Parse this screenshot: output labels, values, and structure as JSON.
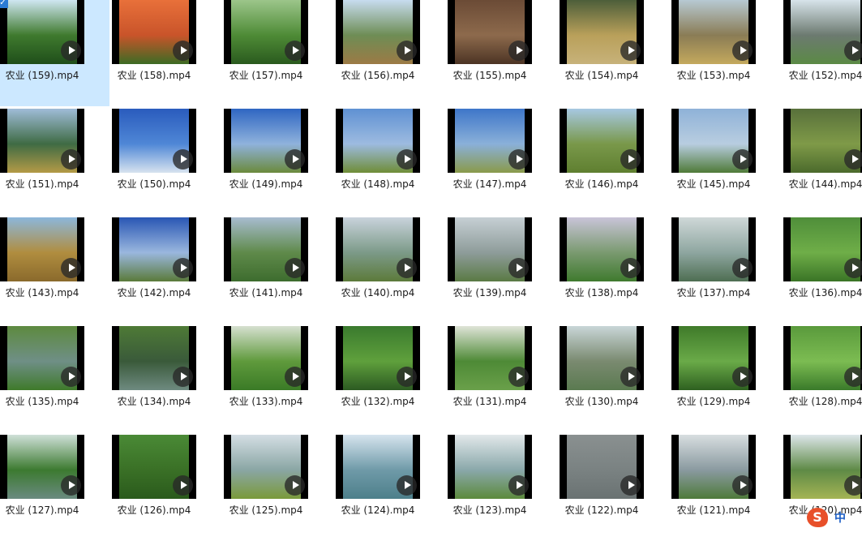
{
  "files": [
    {
      "name": "农业 (159).mp4",
      "g": [
        "#cfe6f2",
        "#3f7a2e",
        "#1f4e1a"
      ],
      "selected": true
    },
    {
      "name": "农业 (158).mp4",
      "g": [
        "#e8703a",
        "#c9542a",
        "#3c6b24"
      ]
    },
    {
      "name": "农业 (157).mp4",
      "g": [
        "#9cc58a",
        "#4e8b36",
        "#2a5a1e"
      ]
    },
    {
      "name": "农业 (156).mp4",
      "g": [
        "#c7dcef",
        "#6e8d55",
        "#9c7a45"
      ]
    },
    {
      "name": "农业 (155).mp4",
      "g": [
        "#6b4b36",
        "#8d6a4c",
        "#4c3424"
      ]
    },
    {
      "name": "农业 (154).mp4",
      "g": [
        "#4d5e3a",
        "#b9a05a",
        "#c7b27a"
      ]
    },
    {
      "name": "农业 (153).mp4",
      "g": [
        "#b7c9d2",
        "#8a7c55",
        "#c4a95d"
      ]
    },
    {
      "name": "农业 (152).mp4",
      "g": [
        "#d7e3ea",
        "#6c7a70",
        "#5b8a45"
      ]
    },
    {
      "name": "农业 (151).mp4",
      "g": [
        "#9fbcd8",
        "#3f6b44",
        "#b49a46"
      ]
    },
    {
      "name": "农业 (150).mp4",
      "g": [
        "#2a5bbd",
        "#4f87d6",
        "#d7e3ef"
      ]
    },
    {
      "name": "农业 (149).mp4",
      "g": [
        "#2f66c2",
        "#8fb2dc",
        "#6b8a3c"
      ]
    },
    {
      "name": "农业 (148).mp4",
      "g": [
        "#5f91d3",
        "#9dbbe0",
        "#6f8d37"
      ]
    },
    {
      "name": "农业 (147).mp4",
      "g": [
        "#3e76c9",
        "#8ab0d9",
        "#8a9a4a"
      ]
    },
    {
      "name": "农业 (146).mp4",
      "g": [
        "#a7c8e2",
        "#79984a",
        "#5f7f30"
      ]
    },
    {
      "name": "农业 (145).mp4",
      "g": [
        "#8fb2d8",
        "#b8cde0",
        "#4f7a38"
      ]
    },
    {
      "name": "农业 (144).mp4",
      "g": [
        "#58703b",
        "#7f9a48",
        "#4b6a2c"
      ]
    },
    {
      "name": "农业 (143).mp4",
      "g": [
        "#8cb7db",
        "#b08d3f",
        "#8a6a2c"
      ]
    },
    {
      "name": "农业 (142).mp4",
      "g": [
        "#2956b4",
        "#9ab7de",
        "#5a7a3a"
      ]
    },
    {
      "name": "农业 (141).mp4",
      "g": [
        "#a8bcd0",
        "#5f8a4a",
        "#3d6c2e"
      ]
    },
    {
      "name": "农业 (140).mp4",
      "g": [
        "#c9d3dc",
        "#7c9a88",
        "#5c7a3a"
      ]
    },
    {
      "name": "农业 (139).mp4",
      "g": [
        "#c6cfd4",
        "#8e9c9a",
        "#5a7a44"
      ]
    },
    {
      "name": "农业 (138).mp4",
      "g": [
        "#c9c4d8",
        "#7a9a70",
        "#3f7a2e"
      ]
    },
    {
      "name": "农业 (137).mp4",
      "g": [
        "#cfd8d8",
        "#8ea6a0",
        "#4e6e52"
      ]
    },
    {
      "name": "农业 (136).mp4",
      "g": [
        "#4f8e3a",
        "#6fae48",
        "#3a7426"
      ]
    },
    {
      "name": "农业 (135).mp4",
      "g": [
        "#5d8a3f",
        "#6f8f86",
        "#3f7a2a"
      ]
    },
    {
      "name": "农业 (134).mp4",
      "g": [
        "#4e7a36",
        "#3a5a3a",
        "#6e8a80"
      ]
    },
    {
      "name": "农业 (133).mp4",
      "g": [
        "#d6e0d0",
        "#5f9a3c",
        "#3a7a26"
      ]
    },
    {
      "name": "农业 (132).mp4",
      "g": [
        "#3a7a2e",
        "#5fa03c",
        "#2c5a22"
      ]
    },
    {
      "name": "农业 (131).mp4",
      "g": [
        "#dfe4d8",
        "#4e8a36",
        "#6aa04a"
      ]
    },
    {
      "name": "农业 (130).mp4",
      "g": [
        "#c9d6d8",
        "#7a8a70",
        "#5a7a50"
      ]
    },
    {
      "name": "农业 (129).mp4",
      "g": [
        "#3f7a2a",
        "#6aaa48",
        "#2e6020"
      ]
    },
    {
      "name": "农业 (128).mp4",
      "g": [
        "#5a9a3c",
        "#7cbc52",
        "#3a7a2a"
      ]
    },
    {
      "name": "农业 (127).mp4",
      "g": [
        "#cfe0d8",
        "#3c7a30",
        "#6a8a80"
      ]
    },
    {
      "name": "农业 (126).mp4",
      "g": [
        "#4a8a36",
        "#3a7026",
        "#2a5a1c"
      ]
    },
    {
      "name": "农业 (125).mp4",
      "g": [
        "#d4dee4",
        "#8aa6a4",
        "#7a9a3a"
      ]
    },
    {
      "name": "农业 (124).mp4",
      "g": [
        "#d6e4ee",
        "#6f9aa8",
        "#4d7f8a"
      ]
    },
    {
      "name": "农业 (123).mp4",
      "g": [
        "#e2e8ea",
        "#8aa8aa",
        "#5c8a3c"
      ]
    },
    {
      "name": "农业 (122).mp4",
      "g": [
        "#8a9090",
        "#7a8282",
        "#6a7272"
      ]
    },
    {
      "name": "农业 (121).mp4",
      "g": [
        "#d8dee0",
        "#8a9aa0",
        "#4e7a3a"
      ]
    },
    {
      "name": "农业 (120).mp4",
      "g": [
        "#dde6ea",
        "#5e8a46",
        "#a4b454"
      ]
    }
  ],
  "ime": {
    "logo": "S",
    "mode": "中"
  }
}
